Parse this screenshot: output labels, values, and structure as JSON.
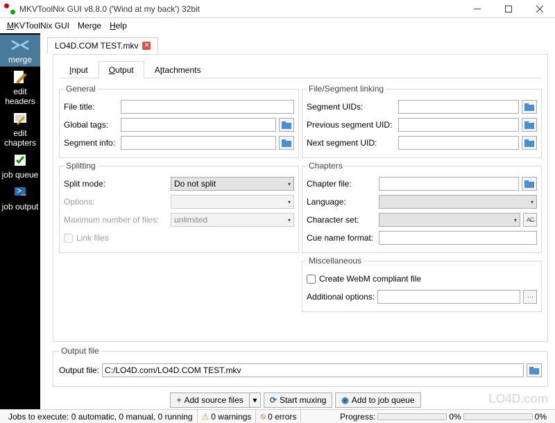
{
  "titlebar": {
    "title": "MKVToolNix GUI v8.8.0 ('Wind at my back') 32bit"
  },
  "menubar": {
    "items": [
      "MKVToolNix GUI",
      "Merge",
      "Help"
    ]
  },
  "sidebar": {
    "items": [
      {
        "label": "merge",
        "icon": "merge-icon"
      },
      {
        "label": "edit headers",
        "icon": "edit-headers-icon"
      },
      {
        "label": "edit chapters",
        "icon": "edit-chapters-icon"
      },
      {
        "label": "job queue",
        "icon": "job-queue-icon"
      },
      {
        "label": "job output",
        "icon": "job-output-icon"
      }
    ]
  },
  "file_tab": {
    "name": "LO4D.COM TEST.mkv"
  },
  "inner_tabs": {
    "input": "Input",
    "output": "Output",
    "attachments": "Attachments"
  },
  "general": {
    "legend": "General",
    "file_title_label": "File title:",
    "file_title_value": "",
    "global_tags_label": "Global tags:",
    "global_tags_value": "",
    "segment_info_label": "Segment info:",
    "segment_info_value": ""
  },
  "splitting": {
    "legend": "Splitting",
    "mode_label": "Split mode:",
    "mode_value": "Do not split",
    "options_label": "Options:",
    "options_value": "",
    "max_label": "Maximum number of files:",
    "max_value": "unlimited",
    "link_label": "Link files"
  },
  "linking": {
    "legend": "File/Segment linking",
    "uids_label": "Segment UIDs:",
    "uids_value": "",
    "prev_label": "Previous segment UID:",
    "prev_value": "",
    "next_label": "Next segment UID:",
    "next_value": ""
  },
  "chapters": {
    "legend": "Chapters",
    "file_label": "Chapter file:",
    "file_value": "",
    "lang_label": "Language:",
    "lang_value": "",
    "charset_label": "Character set:",
    "charset_value": "",
    "cue_label": "Cue name format:",
    "cue_value": ""
  },
  "misc": {
    "legend": "Miscellaneous",
    "webm_label": "Create WebM compliant file",
    "addopt_label": "Additional options:",
    "addopt_value": ""
  },
  "output_file": {
    "legend": "Output file",
    "label": "Output file:",
    "value": "C:/LO4D.com/LO4D.COM TEST.mkv"
  },
  "actions": {
    "add_source": "Add source files",
    "start_muxing": "Start muxing",
    "add_job": "Add to job queue"
  },
  "status": {
    "jobs": "Jobs to execute: 0 automatic, 0 manual, 0 running",
    "warnings": "0 warnings",
    "errors": "0 errors",
    "progress_label": "Progress:",
    "progress_pct1": "0%",
    "progress_pct2": "0%"
  },
  "watermark": "LO4D.com"
}
